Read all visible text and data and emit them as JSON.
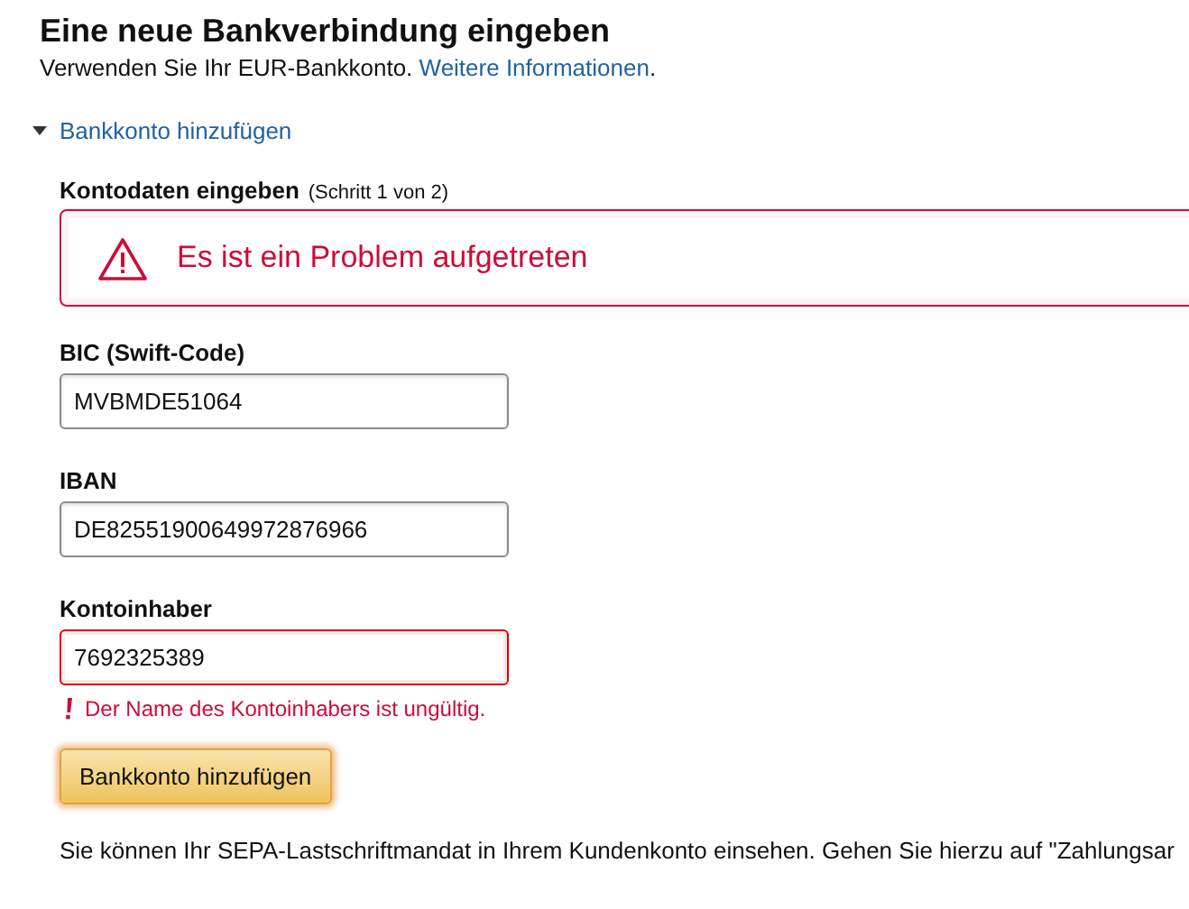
{
  "heading": "Eine neue Bankverbindung eingeben",
  "subtitle": {
    "text": "Verwenden Sie Ihr EUR-Bankkonto.",
    "link": "Weitere Informationen",
    "after": "."
  },
  "expander": {
    "label": "Bankkonto hinzufügen",
    "expanded": true
  },
  "step": {
    "title": "Kontodaten eingeben",
    "note": "(Schritt 1 von 2)"
  },
  "alert": {
    "message": "Es ist ein Problem aufgetreten"
  },
  "fields": [
    {
      "label": "BIC (Swift-Code)",
      "value": "MVBMDE51064",
      "invalid": false
    },
    {
      "label": "IBAN",
      "value": "DE82551900649972876966",
      "invalid": false
    },
    {
      "label": "Kontoinhaber",
      "value": "7692325389",
      "invalid": true,
      "error": "Der Name des Kontoinhabers ist ungültig."
    }
  ],
  "submit_button": "Bankkonto hinzufügen",
  "footer": "Sie können Ihr SEPA-Lastschriftmandat in Ihrem Kundenkonto einsehen. Gehen Sie hierzu auf \"Zahlungsar"
}
